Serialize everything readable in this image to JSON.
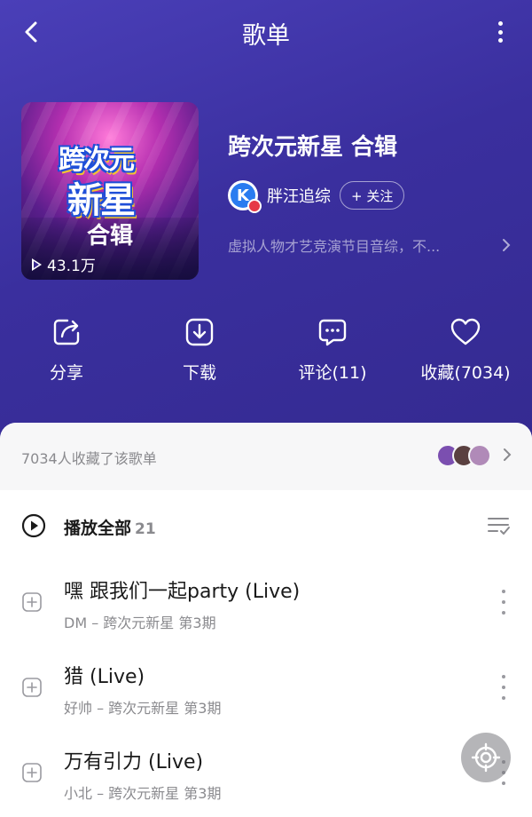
{
  "header": {
    "title": "歌单"
  },
  "playlist": {
    "cover_logo_line1": "跨次元",
    "cover_logo_line2": "新星",
    "cover_badge": "合辑",
    "play_count": "43.1万",
    "title": "跨次元新星 合辑",
    "creator": {
      "avatar_letter": "K",
      "name": "胖汪追综",
      "follow_label": "+ 关注"
    },
    "description": "虚拟人物才艺竞演节目音综，不..."
  },
  "actions": [
    {
      "icon": "share-icon",
      "label": "分享"
    },
    {
      "icon": "download-icon",
      "label": "下载"
    },
    {
      "icon": "comment-icon",
      "label": "评论(11)"
    },
    {
      "icon": "heart-icon",
      "label": "收藏(7034)"
    }
  ],
  "collectors": {
    "text": "7034人收藏了该歌单",
    "avatar_colors": [
      "#7b4fb0",
      "#5a4040",
      "#b08ab8"
    ]
  },
  "play_all": {
    "label": "播放全部",
    "count": "21"
  },
  "songs": [
    {
      "title": "嘿 跟我们一起party (Live)",
      "subtitle": "DM – 跨次元新星 第3期"
    },
    {
      "title": "猎 (Live)",
      "subtitle": "好帅 – 跨次元新星 第3期"
    },
    {
      "title": "万有引力 (Live)",
      "subtitle": "小北 – 跨次元新星 第3期"
    }
  ],
  "colors": {
    "hero_bg": "#3b32a6",
    "accent_blue": "#2a7cf0"
  }
}
